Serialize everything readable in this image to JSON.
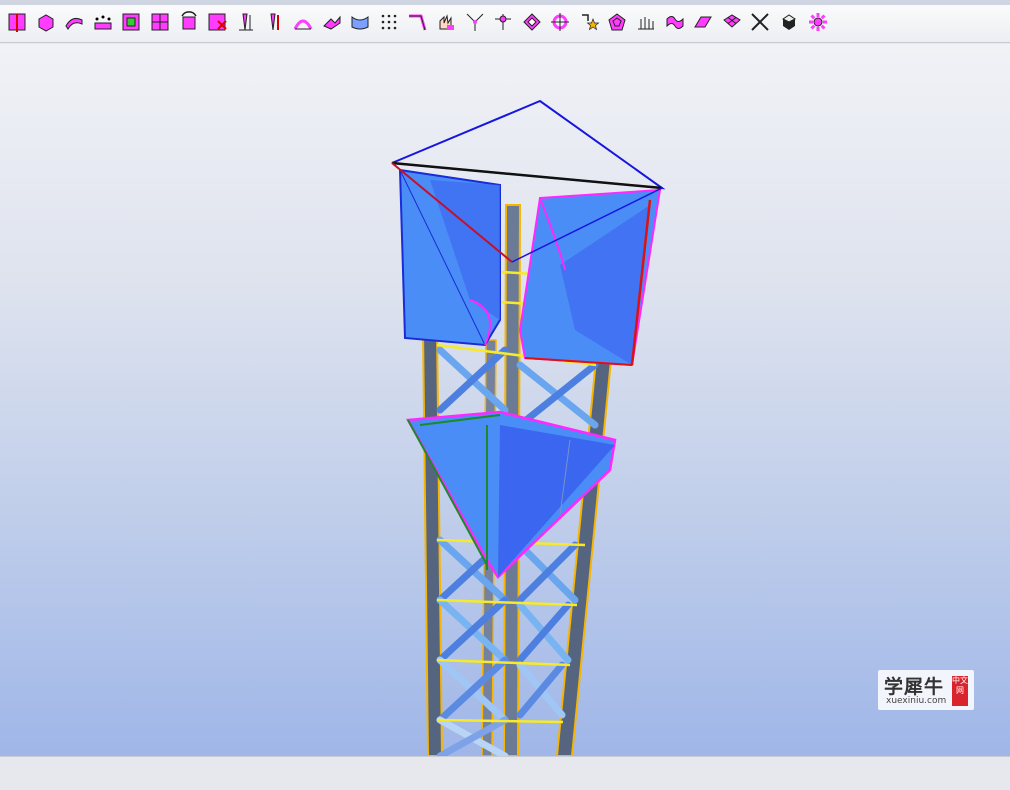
{
  "toolbar": {
    "tools": [
      {
        "icon": "split-solid-icon"
      },
      {
        "icon": "cube-box-icon"
      },
      {
        "icon": "bent-plate-icon"
      },
      {
        "icon": "beam-points-icon"
      },
      {
        "icon": "check-box-icon"
      },
      {
        "icon": "grid-panel-icon"
      },
      {
        "icon": "rotate-object-icon"
      },
      {
        "icon": "delete-grid-icon"
      },
      {
        "icon": "column-axis-icon"
      },
      {
        "icon": "column-rebar-icon"
      },
      {
        "icon": "arch-bridge-icon"
      },
      {
        "icon": "fold-plate-icon"
      },
      {
        "icon": "curved-surface-icon"
      },
      {
        "icon": "dot-grid-icon"
      },
      {
        "icon": "polyline-icon"
      },
      {
        "icon": "hand-pick-icon"
      },
      {
        "icon": "node-split-icon"
      },
      {
        "icon": "tripod-node-icon"
      },
      {
        "icon": "diamond-plate-icon"
      },
      {
        "icon": "target-node-icon"
      },
      {
        "icon": "star-transform-icon"
      },
      {
        "icon": "polygon-mesh-icon"
      },
      {
        "icon": "comb-profile-icon"
      },
      {
        "icon": "twisted-plate-icon"
      },
      {
        "icon": "skew-plate-icon"
      },
      {
        "icon": "mesh-plate-icon"
      },
      {
        "icon": "cross-joint-icon"
      },
      {
        "icon": "black-solid-icon"
      },
      {
        "icon": "gear-settings-icon"
      }
    ]
  },
  "viewport": {
    "scene": "3d-steel-tower-model"
  },
  "watermark": {
    "main": "学犀牛",
    "sub": "xuexiniu.com",
    "badge": "中文网"
  }
}
